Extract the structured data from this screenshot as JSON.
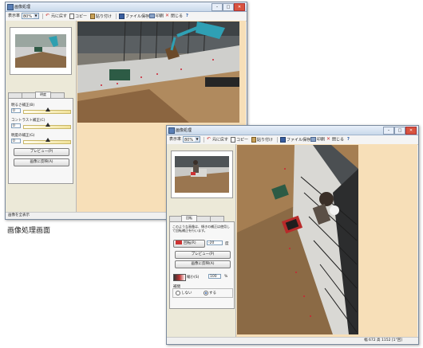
{
  "window1": {
    "title": "画像処理",
    "toolbar": {
      "display_label": "表示率",
      "zoom_value": "80%",
      "undo": "元に戻す",
      "copy": "コピー",
      "paste": "貼り付け",
      "save": "ファイル保存",
      "print": "印刷",
      "close": "閉じる",
      "help": "?"
    },
    "tabs": [
      "",
      "",
      "明度",
      ""
    ],
    "labels": {
      "brightness": "明るさ補正(B)",
      "contrast": "コントラスト補正(C)",
      "gamma": "明度の補正(G)"
    },
    "values": {
      "brightness": "0",
      "contrast": "0",
      "gamma": "0"
    },
    "levels": {
      "brightness": 0.5,
      "contrast": 0.5,
      "gamma": 0.5
    },
    "buttons": {
      "preview": "プレビュー(P)",
      "apply": "画像に反映(A)"
    },
    "status": "画像を全表示"
  },
  "window2": {
    "title": "画像処理",
    "toolbar": {
      "display_label": "表示率",
      "zoom_value": "80%",
      "undo": "元に戻す",
      "copy": "コピー",
      "paste": "貼り付け",
      "save": "ファイル保存",
      "print": "印刷",
      "close": "閉じる",
      "help": "?"
    },
    "tabs": [
      "",
      "回転",
      "",
      ""
    ],
    "description": "このような画像は、傾きの補正は使用して回転補正を行います。",
    "rotate_label": "回転(R)",
    "angle_value": "-20",
    "angle_unit": "度",
    "buttons": {
      "preview": "プレビュー(P)",
      "apply": "画像に反映(A)"
    },
    "scale_label": "縮小(S)",
    "scale_value": "100",
    "scale_unit": "%",
    "group_label": "補間",
    "radio_options": [
      "しない",
      "する"
    ],
    "status": "幅 672 高 1152 [1°回]"
  },
  "caption": "画像処理画面",
  "colors": {
    "canvas_bg": "#f7dfb8",
    "accent": "#1a4fa0",
    "slider": "#f2e39a"
  }
}
